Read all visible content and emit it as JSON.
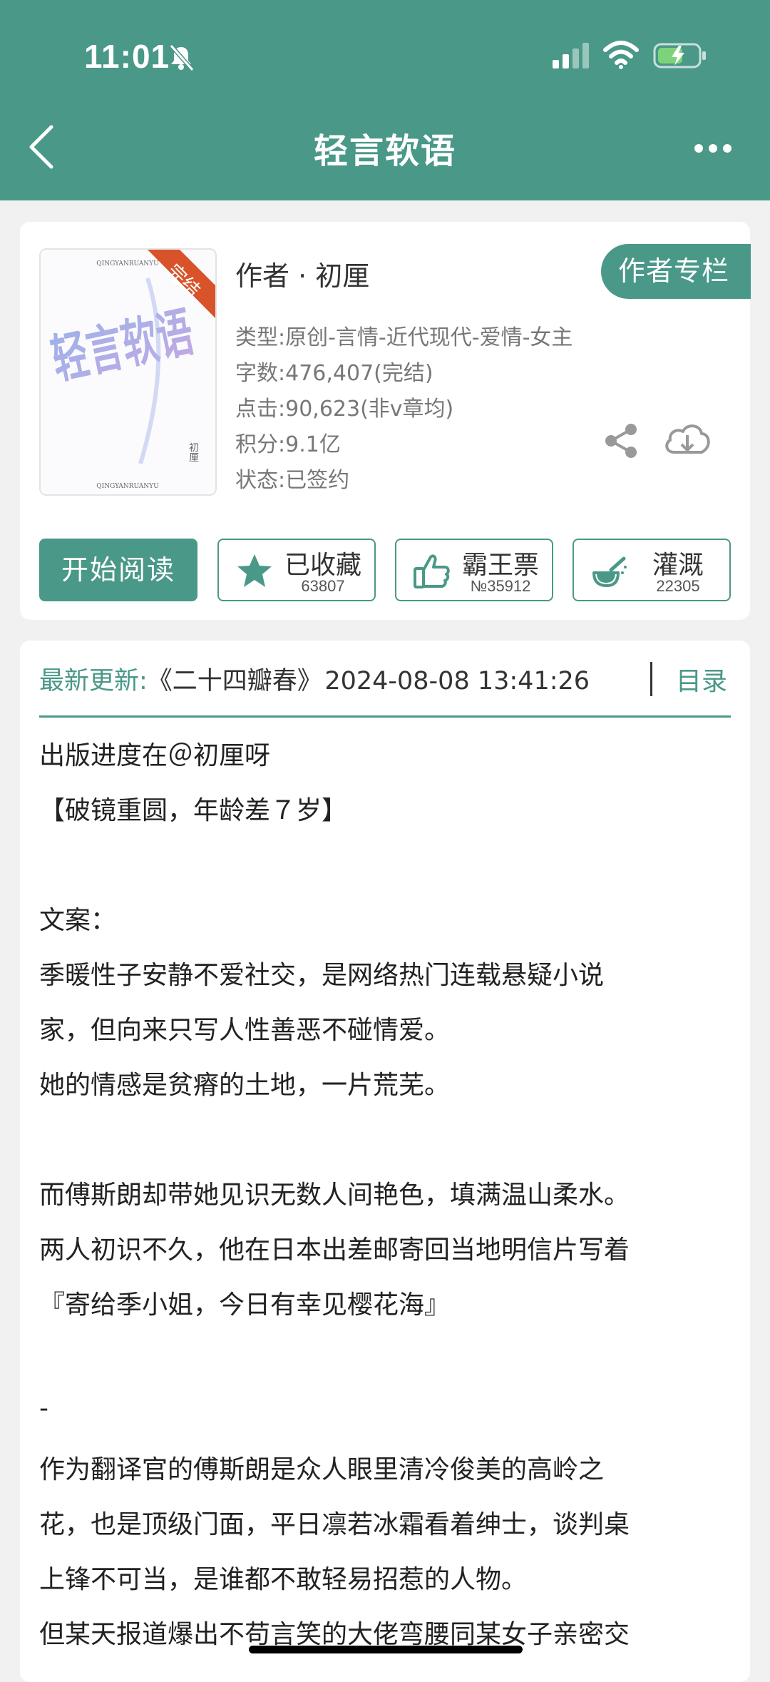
{
  "status_bar": {
    "time": "11:01"
  },
  "nav": {
    "title": "轻言软语"
  },
  "book": {
    "cover_title": "轻言软语",
    "cover_badge": "完结",
    "cover_top_text": "QINGYANRUANYU",
    "cover_bottom_text": "QINGYANRUANYU",
    "cover_author": "初厘",
    "author_line": "作者 · 初厘",
    "author_column_label": "作者专栏",
    "genre": "类型:原创-言情-近代现代-爱情-女主",
    "word_count": "字数:476,407(完结)",
    "clicks": "点击:90,623(非v章均)",
    "points": "积分:9.1亿",
    "status": "状态:已签约"
  },
  "actions": {
    "read_label": "开始阅读",
    "favorite": {
      "label": "已收藏",
      "count": "63807"
    },
    "ticket": {
      "label": "霸王票",
      "count": "№35912"
    },
    "water": {
      "label": "灌溉",
      "count": "22305"
    }
  },
  "update": {
    "label": "最新更新:",
    "chapter": "《二十四瓣春》",
    "time": "2024-08-08 13:41:26",
    "toc_label": "目录"
  },
  "description": [
    "出版进度在＠初厘呀",
    "【破镜重圆，年龄差７岁】",
    "",
    "文案：",
    "季暖性子安静不爱社交，是网络热门连载悬疑小说",
    "家，但向来只写人性善恶不碰情爱。",
    "她的情感是贫瘠的土地，一片荒芜。",
    "",
    "而傅斯朗却带她见识无数人间艳色，填满温山柔水。",
    "两人初识不久，他在日本出差邮寄回当地明信片写着",
    "『寄给季小姐，今日有幸见樱花海』",
    "",
    "-",
    "作为翻译官的傅斯朗是众人眼里清冷俊美的高岭之",
    "花，也是顶级门面，平日凛若冰霜看着绅士，谈判桌",
    "上锋不可当，是谁都不敢轻易招惹的人物。",
    "但某天报道爆出不苟言笑的大佬弯腰同某女子亲密交"
  ],
  "colors": {
    "brand": "#4a9888",
    "badge": "#d9532a"
  }
}
